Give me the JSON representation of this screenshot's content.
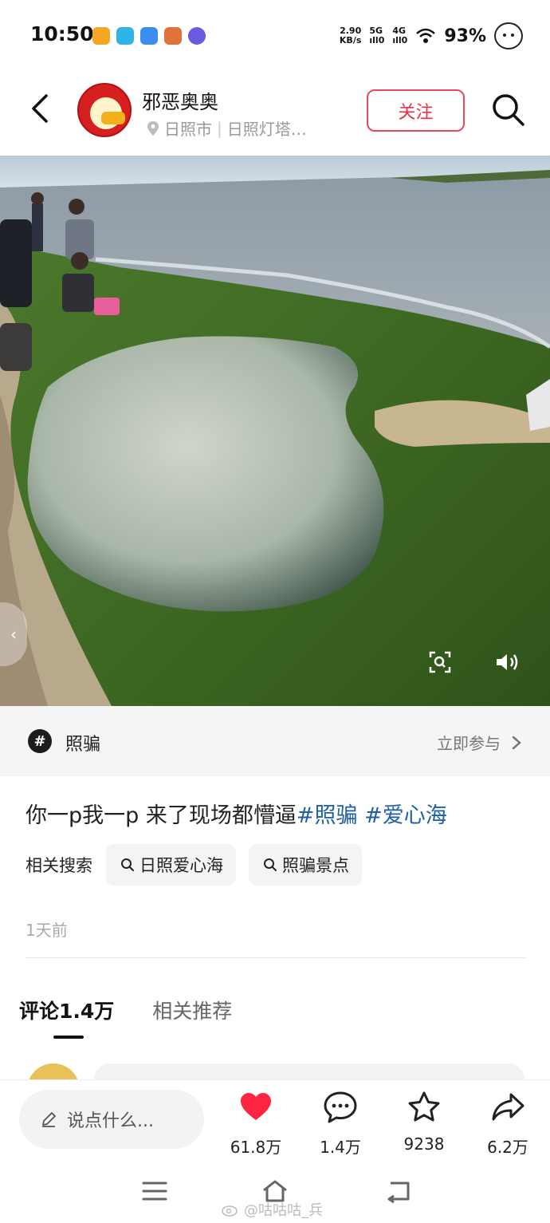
{
  "status_bar": {
    "time": "10:50",
    "net_speed_value": "2.90",
    "net_speed_unit": "KB/s",
    "signal_1": "5G",
    "signal_2": "4G",
    "battery": "93%"
  },
  "header": {
    "username": "邪恶奥奥",
    "location_city": "日照市",
    "location_place": "日照灯塔…",
    "follow_label": "关注"
  },
  "topic": {
    "icon_text": "#",
    "name": "照骗",
    "join_label": "立即参与"
  },
  "post": {
    "caption_text": "你一p我一p 来了现场都懵逼",
    "hashtags": [
      "#照骗",
      "#爱心海"
    ],
    "related_label": "相关搜索",
    "related_searches": [
      "日照爱心海",
      "照骗景点"
    ],
    "time_ago": "1天前"
  },
  "tabs": [
    {
      "label": "评论1.4万",
      "active": true
    },
    {
      "label": "相关推荐",
      "active": false
    }
  ],
  "action_bar": {
    "input_placeholder": "说点什么...",
    "likes": "61.8万",
    "comments": "1.4万",
    "favorites": "9238",
    "shares": "6.2万"
  },
  "watermark": "@咕咕咕_兵",
  "colors": {
    "accent_red": "#e8304a",
    "hashtag_blue": "#1f5fa6",
    "like_red": "#ff2442"
  },
  "icons": [
    "back-arrow-icon",
    "location-pin-icon",
    "search-icon",
    "zoom-icon",
    "sound-icon",
    "topic-hash-icon",
    "chevron-right-icon",
    "pen-icon",
    "heart-icon",
    "comment-icon",
    "star-icon",
    "share-icon",
    "menu-icon",
    "home-icon",
    "back-nav-icon"
  ]
}
